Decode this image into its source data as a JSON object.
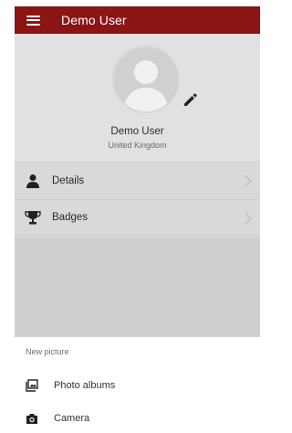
{
  "appbar": {
    "title": "Demo User",
    "menu_icon": "hamburger-menu-icon"
  },
  "profile": {
    "name": "Demo User",
    "country": "United Kingdom",
    "avatar_icon": "person-silhouette-icon",
    "edit_icon": "pencil-icon"
  },
  "menu_rows": [
    {
      "label": "Details",
      "icon": "person-icon"
    },
    {
      "label": "Badges",
      "icon": "trophy-icon"
    }
  ],
  "sheet": {
    "title": "New picture",
    "items": [
      {
        "label": "Photo albums",
        "icon": "photo-library-icon"
      },
      {
        "label": "Camera",
        "icon": "camera-icon"
      }
    ]
  },
  "colors": {
    "appbar": "#8b1414",
    "sheet_bg": "#ffffff",
    "dim_overlay": "#d9d9d9"
  }
}
